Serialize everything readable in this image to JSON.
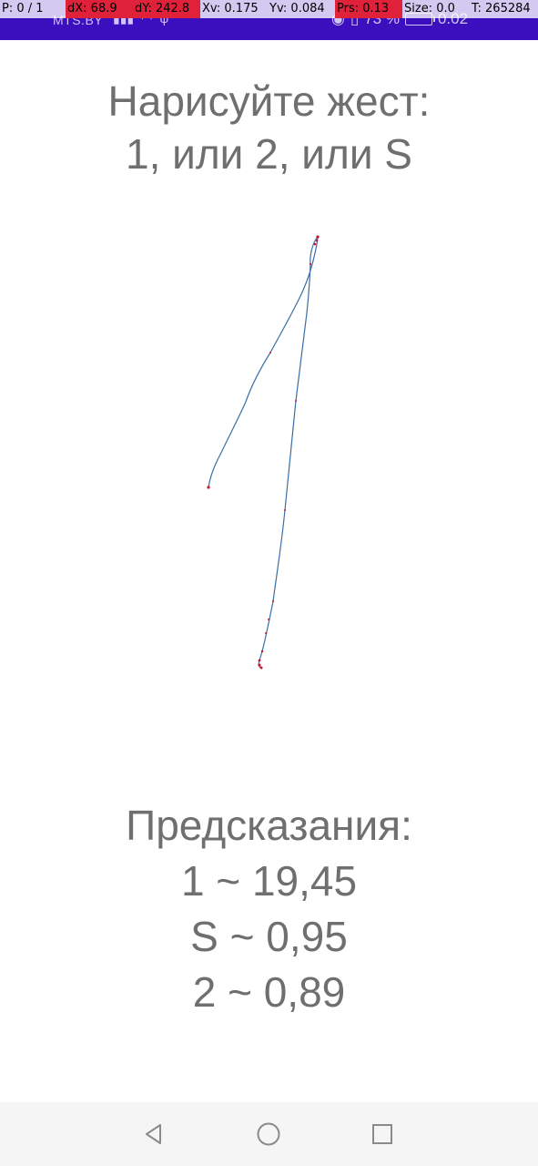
{
  "status_bar": {
    "carrier": "MTS.BY",
    "battery": "73 %",
    "network_speed": "0.02",
    "icons": [
      "signal-icon",
      "wifi-icon",
      "usb-icon",
      "eye-icon",
      "vibrate-icon",
      "battery-icon"
    ]
  },
  "debug_overlay": {
    "pointer": "P: 0 / 1",
    "dx": "dX: 68.9",
    "dy": "dY: 242.8",
    "xv": "Xv: 0.175",
    "yv": "Yv: 0.084",
    "prs": "Prs: 0.13",
    "size": "Size: 0.0",
    "t": "T: 265284"
  },
  "prompt": {
    "line1": "Нарисуйте жест:",
    "line2": "1, или 2, или S"
  },
  "predictions": {
    "title": "Предсказания:",
    "items": [
      {
        "text": "1 ~ 19,45"
      },
      {
        "text": "S ~ 0,95"
      },
      {
        "text": "2 ~ 0,89"
      }
    ]
  },
  "colors": {
    "status_bar": "#3b0fbd",
    "debug_highlight": "#e0213a",
    "text": "#6f6f6f",
    "stroke": "#3a6ea5",
    "stroke_points": "#d0102c",
    "nav_icon": "#8a8a8a"
  },
  "nav_bar": {
    "icons": [
      "back-icon",
      "home-icon",
      "recent-apps-icon"
    ]
  }
}
